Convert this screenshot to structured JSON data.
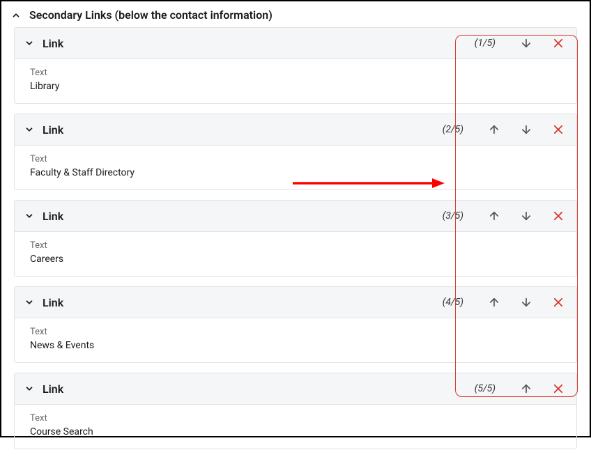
{
  "section": {
    "title": "Secondary Links (below the contact information)"
  },
  "items": [
    {
      "label": "Link",
      "counter": "(1/5)",
      "field_label": "Text",
      "field_value": "Library",
      "up": false,
      "down": true
    },
    {
      "label": "Link",
      "counter": "(2/5)",
      "field_label": "Text",
      "field_value": "Faculty & Staff Directory",
      "up": true,
      "down": true
    },
    {
      "label": "Link",
      "counter": "(3/5)",
      "field_label": "Text",
      "field_value": "Careers",
      "up": true,
      "down": true
    },
    {
      "label": "Link",
      "counter": "(4/5)",
      "field_label": "Text",
      "field_value": "News & Events",
      "up": true,
      "down": true
    },
    {
      "label": "Link",
      "counter": "(5/5)",
      "field_label": "Text",
      "field_value": "Course Search",
      "up": true,
      "down": false
    }
  ]
}
